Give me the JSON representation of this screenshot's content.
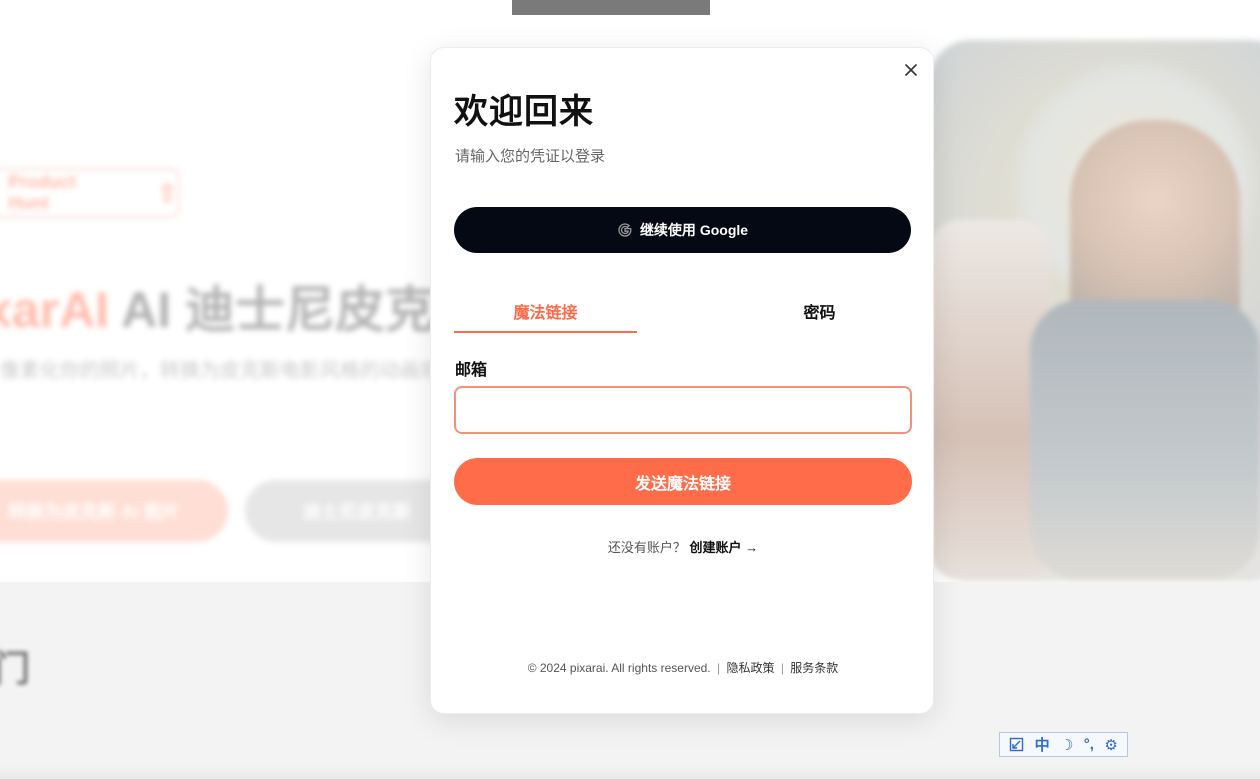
{
  "background": {
    "badge": {
      "label": "Product Hunt",
      "arrow": "⇧"
    },
    "hero": {
      "brand": "xarAI",
      "title_rest": " AI 迪士尼皮克斯",
      "subtitle": "像素化你的照片，转换为皮克斯电影风格的动画效果！"
    },
    "buttons": {
      "primary": "转换为皮克斯 AI 图片",
      "secondary": "迪士尼皮克斯"
    },
    "section_glyph": "门"
  },
  "modal": {
    "close_icon": "×",
    "title": "欢迎回来",
    "subtitle": "请输入您的凭证以登录",
    "google_button": {
      "label": "继续使用 Google"
    },
    "tabs": [
      {
        "label": "魔法链接",
        "active": true
      },
      {
        "label": "密码",
        "active": false
      }
    ],
    "email_label": "邮箱",
    "email_value": "",
    "email_placeholder": "",
    "send_button": "发送魔法链接",
    "signup": {
      "prompt": "还没有账户？",
      "link": "创建账户",
      "arrow": "→"
    },
    "footer": {
      "copyright": "© 2024 pixarai. All rights reserved.",
      "privacy": "隐私政策",
      "terms": "服务条款",
      "separator": "|"
    }
  },
  "ime_toolbar": {
    "mode": "中",
    "moon": "☽",
    "punct": "°,",
    "settings": "⚙"
  },
  "colors": {
    "accent": "#ff6c4a",
    "google_button_bg": "#050914",
    "input_border": "#f3917a"
  }
}
